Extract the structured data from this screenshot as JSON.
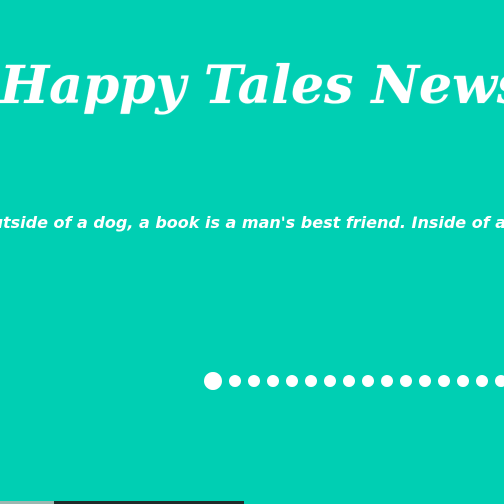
{
  "header": {
    "title": "Happy Tales News"
  },
  "tagline": {
    "text": "Outside of a dog, a book is a man's best friend. Inside of a dog it's too dark to read."
  },
  "carousel": {
    "dot_count": 16,
    "active_index": 0
  },
  "colors": {
    "background": "#00cfb3",
    "text": "#ffffff",
    "dot": "#ffffff"
  }
}
